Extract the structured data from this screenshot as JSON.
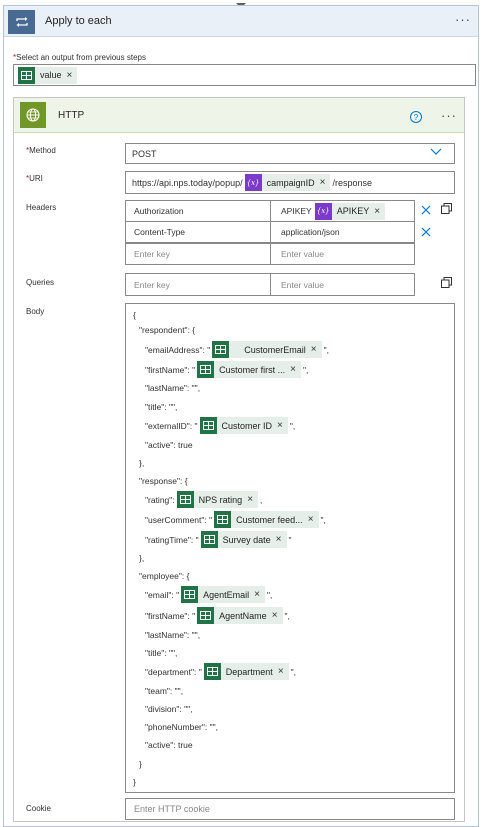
{
  "loop": {
    "title": "Apply to each",
    "output_label": "Select an output from previous steps",
    "output_token": "value"
  },
  "http": {
    "title": "HTTP",
    "method_label": "Method",
    "method_value": "POST",
    "uri_label": "URI",
    "uri_prefix": "https://api.nps.today/popup/",
    "uri_token": "campaignID",
    "uri_suffix": "/response",
    "headers_label": "Headers",
    "headers": [
      {
        "key": "Authorization",
        "value_prefix": "APIKEY",
        "value_token": "APIKEY"
      },
      {
        "key": "Content-Type",
        "value": "application/json"
      }
    ],
    "enter_key": "Enter key",
    "enter_value": "Enter value",
    "queries_label": "Queries",
    "body_label": "Body",
    "cookie_label": "Cookie",
    "cookie_placeholder": "Enter HTTP cookie"
  },
  "body": {
    "l1": "{",
    "l2": "\"respondent\": {",
    "l3_pre": "\"emailAddress\": \"",
    "l3_tok": "CustomerEmail",
    "l3_post": "\",",
    "l4_pre": "\"firstName\": \"",
    "l4_tok": "Customer first ...",
    "l4_post": "\",",
    "l5": "\"lastName\": \"\",",
    "l6": "\"title\": \"\",",
    "l7_pre": "\"externalID\": \"",
    "l7_tok": "Customer ID",
    "l7_post": "\",",
    "l8": "\"active\": true",
    "l9": "},",
    "l10": "\"response\": {",
    "l11_pre": "\"rating\":",
    "l11_tok": "NPS rating",
    "l11_post": ",",
    "l12_pre": "\"userComment\": \"",
    "l12_tok": "Customer feed...",
    "l12_post": "\",",
    "l13_pre": "\"ratingTime\": \"",
    "l13_tok": "Survey date",
    "l13_post": "\"",
    "l14": "},",
    "l15": "\"employee\": {",
    "l16_pre": "\"email\": \"",
    "l16_tok": "AgentEmail",
    "l16_post": "\",",
    "l17_pre": "\"firstName\": \"",
    "l17_tok": "AgentName",
    "l17_post": "\",",
    "l18": "\"lastName\": \"\",",
    "l19": "\"title\": \"\",",
    "l20_pre": "\"department\": \"",
    "l20_tok": "Department",
    "l20_post": "\",",
    "l21": "\"team\": \"\",",
    "l22": "\"division\": \"\",",
    "l23": "\"phoneNumber\": \"\",",
    "l24": "\"active\": true",
    "l25": "}",
    "l26": "}"
  },
  "colors": {
    "loop_accent": "#486991",
    "http_accent": "#709727",
    "excel_green": "#217346",
    "variable_purple": "#7b3ac9",
    "link_blue": "#0078d4"
  },
  "icons": [
    "loop-icon",
    "globe-icon",
    "excel-icon",
    "variable-icon",
    "help-icon",
    "more-icon",
    "close-icon",
    "chevron-down-icon",
    "copy-icon"
  ]
}
